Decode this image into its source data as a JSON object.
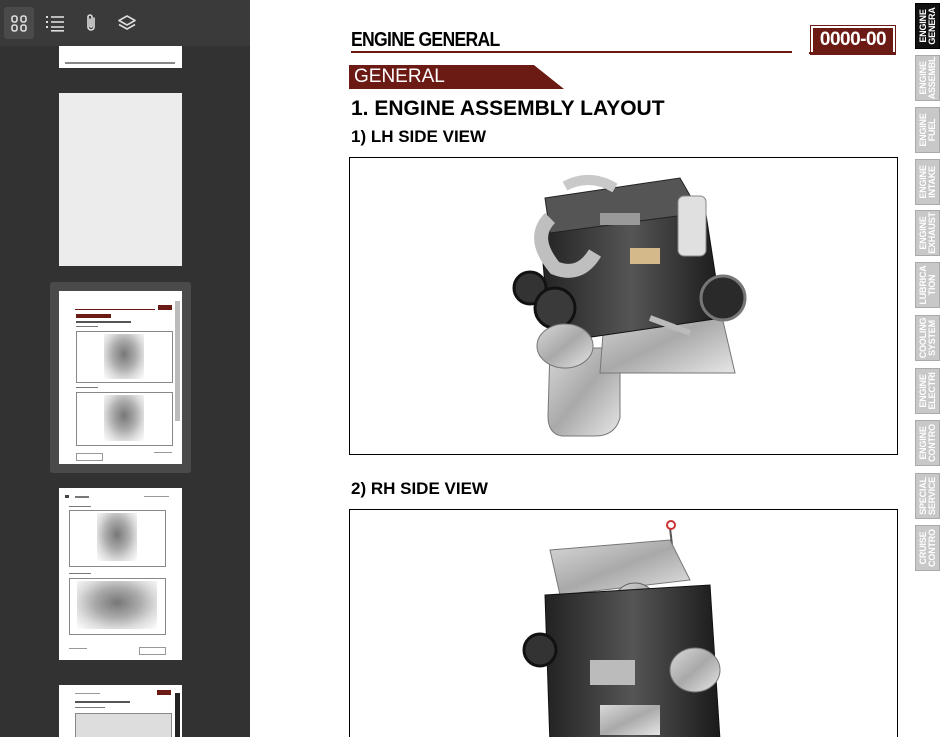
{
  "toolbar": {
    "buttons": [
      {
        "icon": "thumbnails-grid-icon",
        "active": true
      },
      {
        "icon": "outline-list-icon"
      },
      {
        "icon": "attachment-icon"
      },
      {
        "icon": "layers-icon"
      }
    ]
  },
  "document": {
    "header_title": "ENGINE GENERAL",
    "page_code": "0000-00",
    "section_banner": "GENERAL",
    "heading": "1. ENGINE ASSEMBLY LAYOUT",
    "subheading_1": "1) LH SIDE VIEW",
    "subheading_2": "2) RH SIDE VIEW",
    "accent_color": "#6b1a14"
  },
  "side_tabs": [
    {
      "label": "ENGINE\nGENERA",
      "active": true
    },
    {
      "label": "ENGINE\nASSEMBL"
    },
    {
      "label": "ENGINE\nFUEL"
    },
    {
      "label": "ENGINE\nINTAKE"
    },
    {
      "label": "ENGINE\nEXHAUST"
    },
    {
      "label": "LUBRICA\nTION"
    },
    {
      "label": "COOLING\nSYSTEM"
    },
    {
      "label": "ENGINE\nELECTRI"
    },
    {
      "label": "ENGINE\nCONTRO"
    },
    {
      "label": "SPECIAL\nSERVICE"
    },
    {
      "label": "CRUISE\nCONTRO"
    }
  ]
}
